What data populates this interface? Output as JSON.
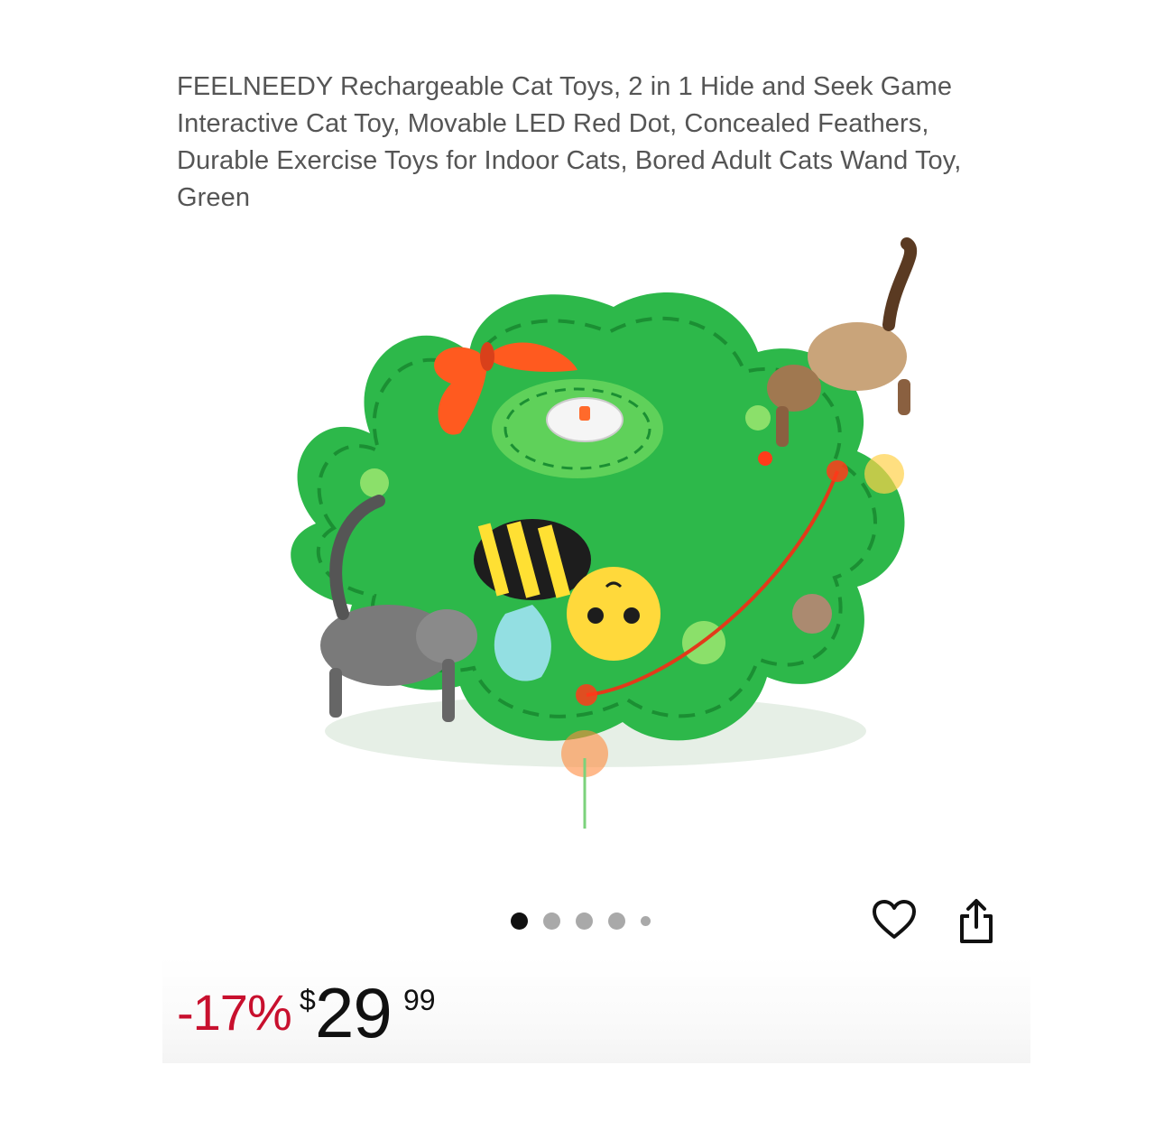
{
  "product": {
    "title": "FEELNEEDY Rechargeable Cat Toys, 2 in 1 Hide and Seek Game Interactive Cat Toy, Movable LED Red Dot, Concealed Feathers, Durable Exercise Toys for Indoor Cats, Bored Adult Cats Wand Toy, Green"
  },
  "gallery": {
    "image_count": 5,
    "active_index": 0
  },
  "actions": {
    "favorite_icon": "heart-outline-icon",
    "share_icon": "share-icon"
  },
  "price": {
    "discount": "-17%",
    "currency": "$",
    "whole": "29",
    "fraction": "99"
  },
  "colors": {
    "discount_red": "#c8102e",
    "mat_green": "#2db84a",
    "active_dot": "#111111",
    "inactive_dot": "#a9a9a9"
  }
}
